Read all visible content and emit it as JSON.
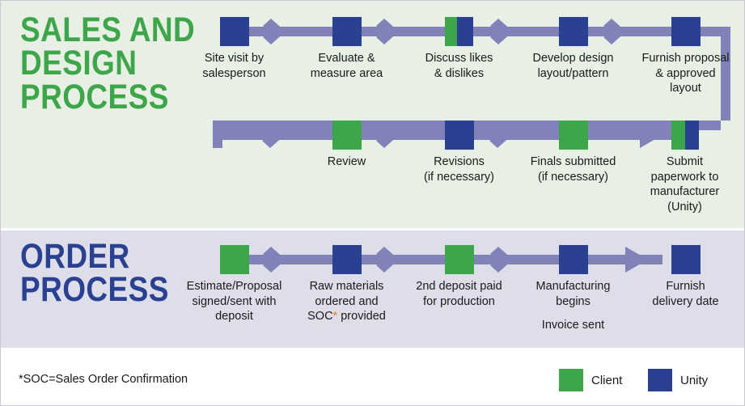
{
  "colors": {
    "client_green": "#3da64a",
    "unity_blue": "#2a4090",
    "connector_purple": "#8182b8",
    "sales_band_bg": "#e8f0e6",
    "order_band_bg": "#dedeea",
    "footer_bg": "#ffffff",
    "text": "#1a1a1a",
    "asterisk_orange": "#e07b2a"
  },
  "sections": {
    "sales": {
      "title": "SALES AND\nDESIGN\nPROCESS",
      "row1": [
        {
          "caption": "Site visit by\nsalesperson",
          "owner": "unity"
        },
        {
          "caption": "Evaluate &\nmeasure area",
          "owner": "unity"
        },
        {
          "caption": "Discuss likes\n& dislikes",
          "owner": "both"
        },
        {
          "caption": "Develop design\nlayout/pattern",
          "owner": "unity"
        },
        {
          "caption": "Furnish proposal\n& approved\nlayout",
          "owner": "unity"
        }
      ],
      "row2": [
        {
          "caption": "Review",
          "owner": "client"
        },
        {
          "caption": "Revisions\n(if necessary)",
          "owner": "unity"
        },
        {
          "caption": "Finals submitted\n(if necessary)",
          "owner": "client"
        },
        {
          "caption": "Submit\npaperwork to\nmanufacturer\n(Unity)",
          "owner": "both"
        }
      ]
    },
    "order": {
      "title": "ORDER\nPROCESS",
      "row1": [
        {
          "caption": "Estimate/Proposal\nsigned/sent with\ndeposit",
          "owner": "client"
        },
        {
          "caption": "Raw materials\nordered and\nSOC* provided",
          "owner": "unity",
          "asterisk": true
        },
        {
          "caption": "2nd deposit paid\nfor production",
          "owner": "client"
        },
        {
          "caption": "Manufacturing\nbegins",
          "subcaption": "Invoice sent",
          "owner": "unity"
        },
        {
          "caption": "Furnish\ndelivery date",
          "owner": "unity"
        }
      ]
    }
  },
  "footer": {
    "footnote": "*SOC=Sales Order Confirmation",
    "legend": [
      {
        "label": "Client",
        "color_key": "client_green",
        "icon": "green-square-swatch"
      },
      {
        "label": "Unity",
        "color_key": "unity_blue",
        "icon": "blue-square-swatch"
      }
    ]
  }
}
